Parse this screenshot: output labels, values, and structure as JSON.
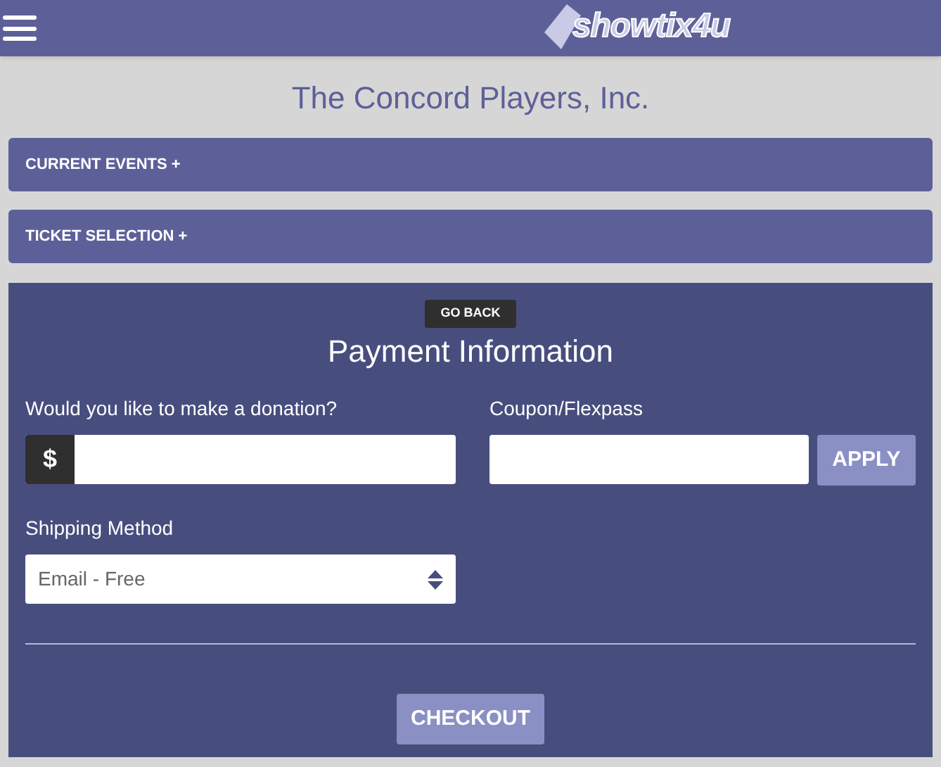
{
  "header": {
    "logo_text": "showtix4u"
  },
  "title": "The Concord Players, Inc.",
  "sections": [
    {
      "label": "CURRENT EVENTS +",
      "expanded": false
    },
    {
      "label": "TICKET SELECTION +",
      "expanded": false
    }
  ],
  "payment": {
    "back_button": "GO BACK",
    "heading": "Payment Information",
    "donation": {
      "label": "Would you like to make a donation?",
      "prefix": "$"
    },
    "coupon": {
      "label": "Coupon/Flexpass",
      "button": "APPLY"
    },
    "shipping": {
      "label": "Shipping Method",
      "value": "Email - Free"
    },
    "checkout": "CHECKOUT"
  }
}
